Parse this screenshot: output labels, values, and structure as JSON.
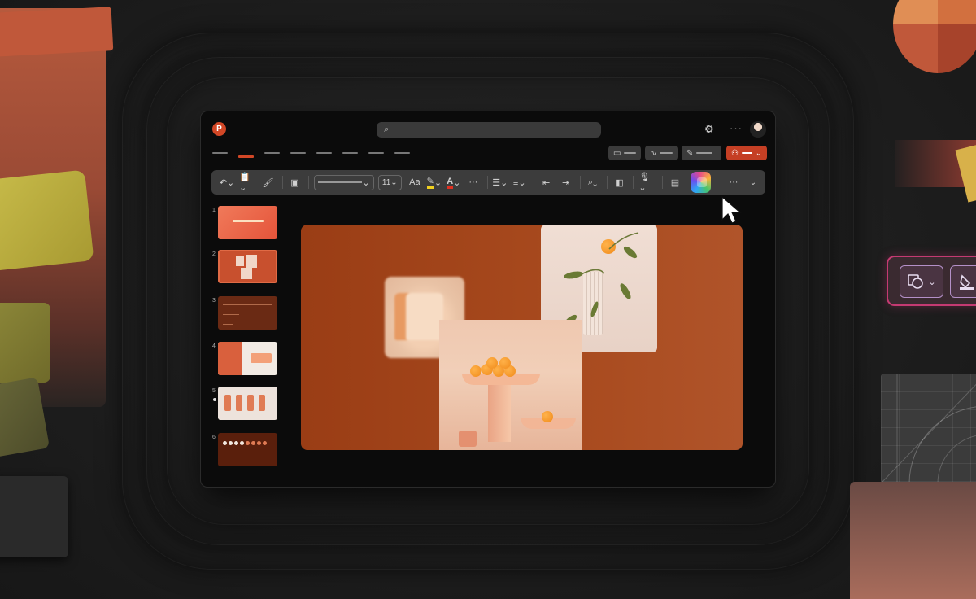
{
  "app": {
    "name": "PowerPoint",
    "logo_letter": "P",
    "brand_color": "#d24726",
    "accent_copilot": "copilot-icon"
  },
  "title_bar": {
    "search_placeholder": "",
    "settings_icon": "gear-icon",
    "more_icon": "ellipsis-icon"
  },
  "ribbon": {
    "font_size": "11",
    "change_case_label": "Aa",
    "font_color_label": "A"
  },
  "slides": [
    {
      "number": "1"
    },
    {
      "number": "2"
    },
    {
      "number": "3"
    },
    {
      "number": "4"
    },
    {
      "number": "5"
    },
    {
      "number": "6"
    }
  ],
  "colors": {
    "accent_button": "#c53f24",
    "highlight_yellow": "#f0d020",
    "font_color_red": "#e03020",
    "pink_outline": "#c43a72"
  }
}
